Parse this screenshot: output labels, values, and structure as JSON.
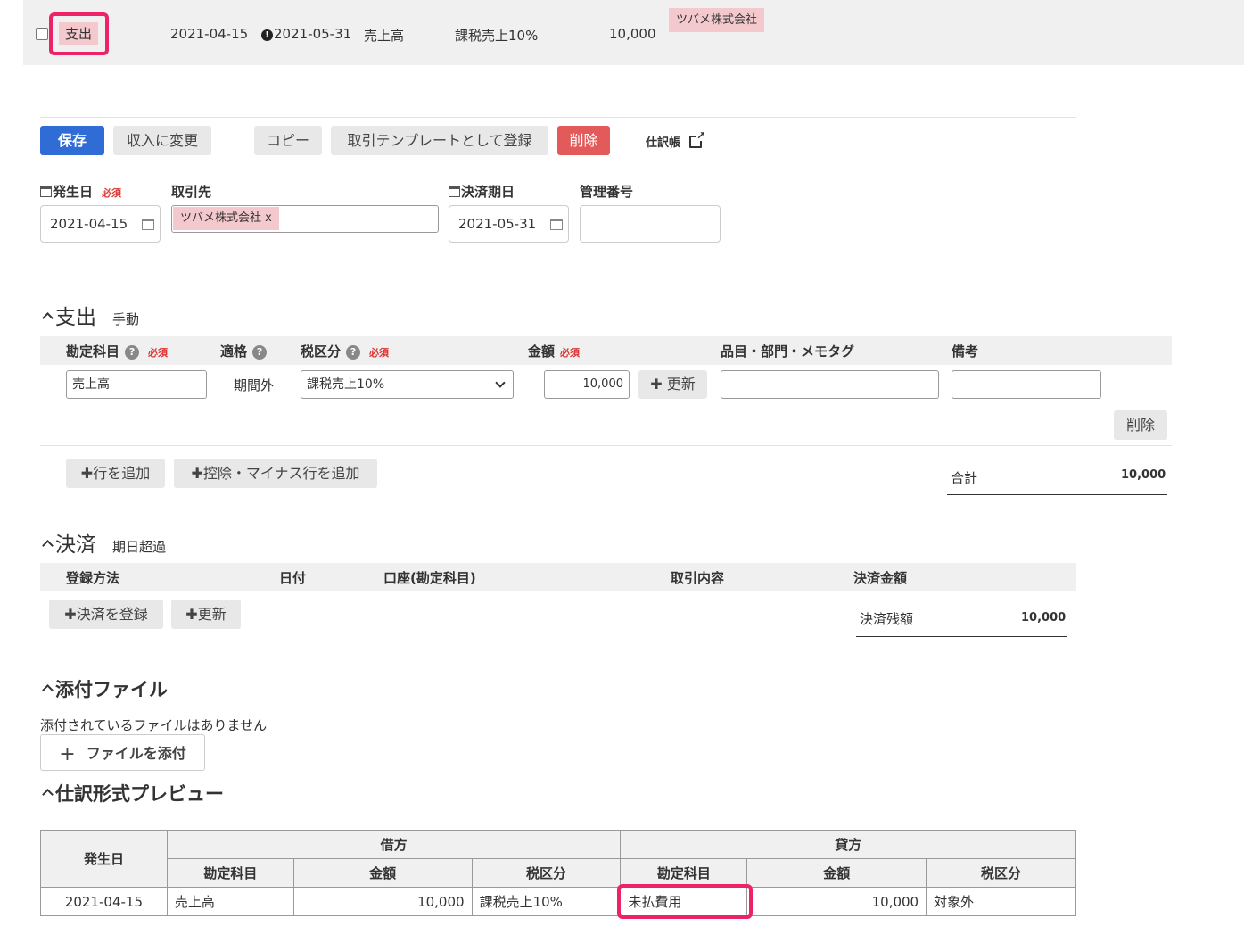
{
  "top_row": {
    "type_badge": "支出",
    "issue_date": "2021-04-15",
    "due_date": "2021-05-31",
    "account": "売上高",
    "tax": "課税売上10%",
    "amount": "10,000",
    "partner": "ツバメ株式会社"
  },
  "toolbar": {
    "save": "保存",
    "change_to_income": "収入に変更",
    "copy": "コピー",
    "register_template": "取引テンプレートとして登録",
    "delete": "削除",
    "journal_link": "仕訳帳"
  },
  "form": {
    "issue_date_label": "発生日",
    "required": "必須",
    "issue_date_value": "2021-04-15",
    "partner_label": "取引先",
    "partner_chip": "ツバメ株式会社 x",
    "due_date_label": "決済期日",
    "due_date_value": "2021-05-31",
    "ref_label": "管理番号",
    "ref_value": ""
  },
  "expense_section": {
    "title": "支出",
    "sub": "手動",
    "headers": {
      "account": "勘定科目",
      "eligible": "適格",
      "tax": "税区分",
      "amount": "金額",
      "items": "品目・部門・メモタグ",
      "notes": "備考"
    },
    "row": {
      "account": "売上高",
      "eligible": "期間外",
      "tax": "課税売上10%",
      "amount": "10,000",
      "update": "更新",
      "items": "",
      "notes": ""
    },
    "delete": "削除",
    "add_row": "行を追加",
    "add_deduction_row": "控除・マイナス行を追加",
    "total_label": "合計",
    "total_value": "10,000"
  },
  "settlement_section": {
    "title": "決済",
    "sub": "期日超過",
    "headers": {
      "method": "登録方法",
      "date": "日付",
      "account": "口座(勘定科目)",
      "description": "取引内容",
      "amount": "決済金額"
    },
    "register": "決済を登録",
    "update": "更新",
    "balance_label": "決済残額",
    "balance_value": "10,000"
  },
  "attachment_section": {
    "title": "添付ファイル",
    "empty": "添付されているファイルはありません",
    "attach_button": "ファイルを添付"
  },
  "preview_section": {
    "title": "仕訳形式プレビュー",
    "date_header": "発生日",
    "debit_header": "借方",
    "credit_header": "貸方",
    "account_header": "勘定科目",
    "amount_header": "金額",
    "tax_header": "税区分",
    "row": {
      "date": "2021-04-15",
      "debit_account": "売上高",
      "debit_amount": "10,000",
      "debit_tax": "課税売上10%",
      "credit_account": "未払費用",
      "credit_amount": "10,000",
      "credit_tax": "対象外"
    }
  },
  "colors": {
    "highlight": "#ee2266",
    "primary": "#2f6cd6",
    "danger": "#e35a5a",
    "tag": "#f3c9cd"
  }
}
